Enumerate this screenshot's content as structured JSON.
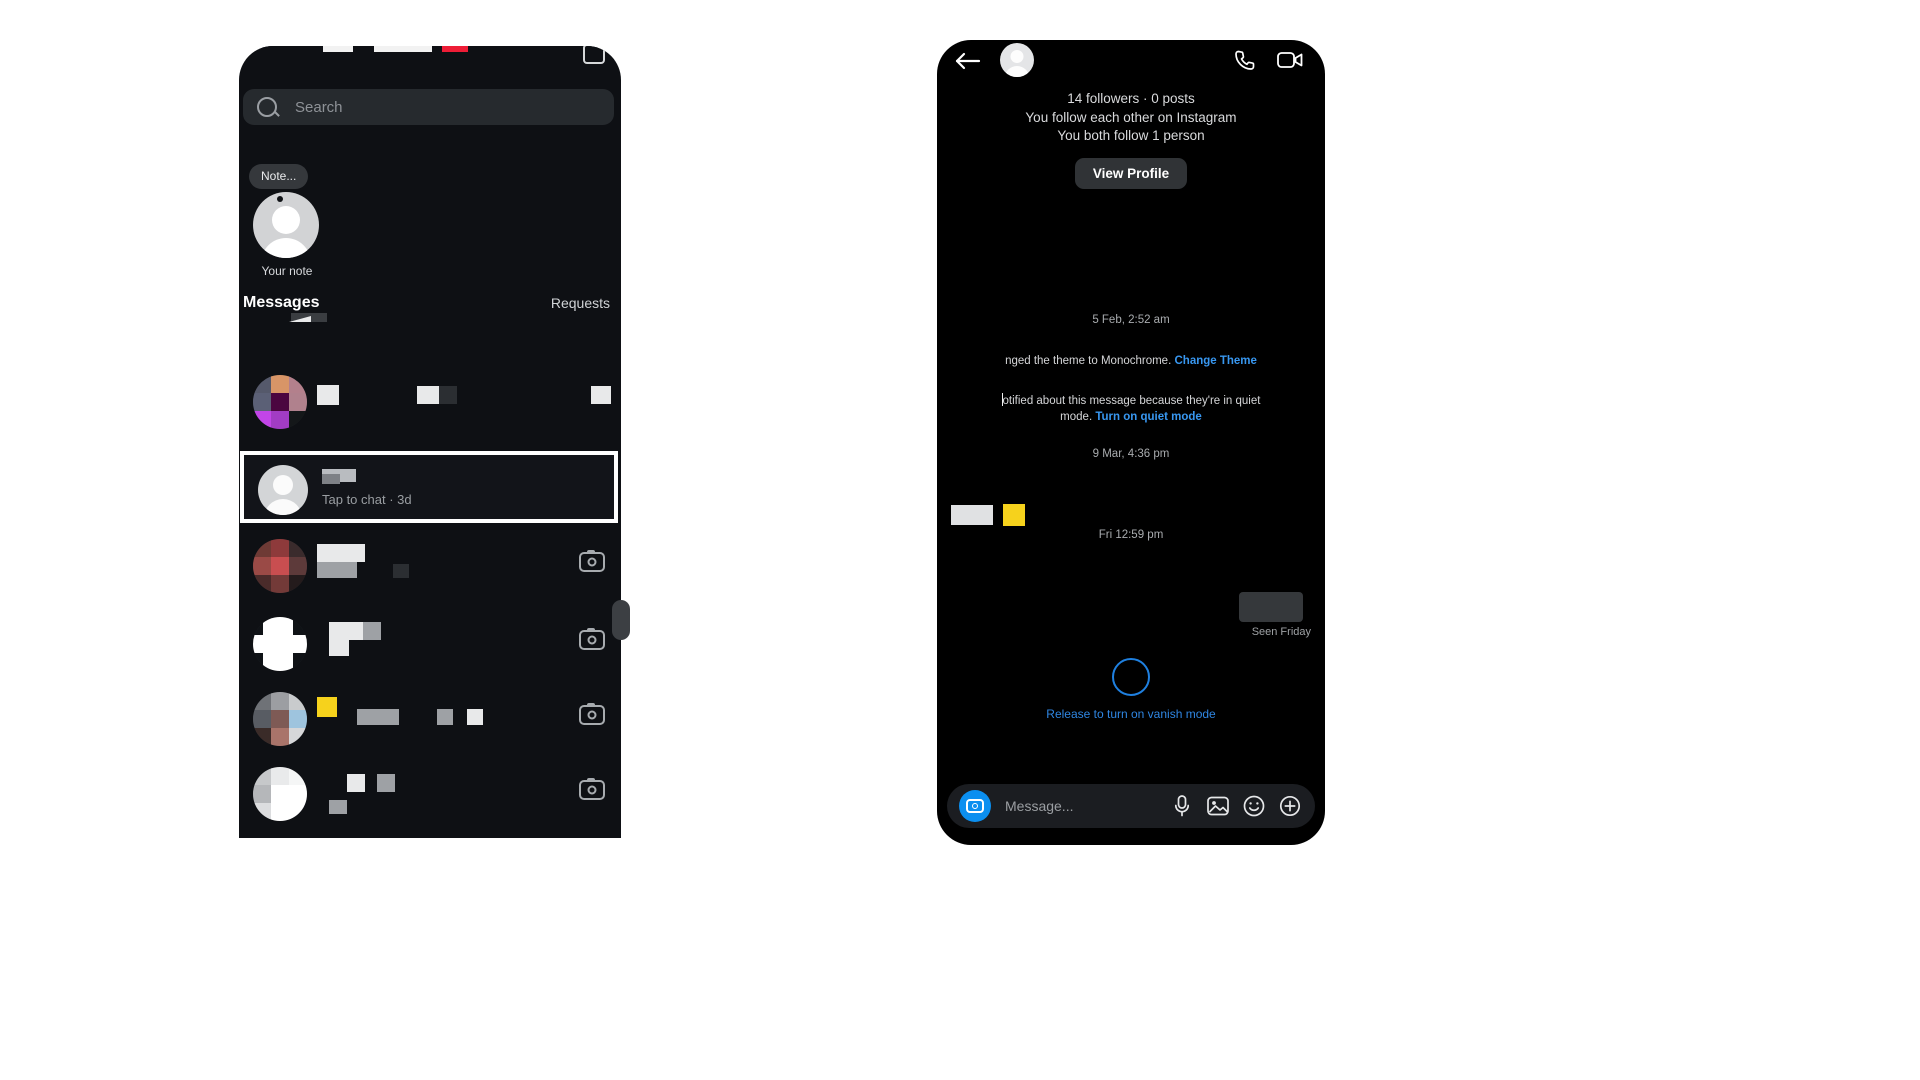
{
  "left_phone": {
    "search": {
      "placeholder": "Search"
    },
    "notes": {
      "bubble_label": "Note...",
      "avatar_label": "Your note"
    },
    "tabs": {
      "messages_label": "Messages",
      "requests_label": "Requests"
    },
    "highlighted_chat": {
      "preview": "Tap to chat · 3d"
    },
    "icons": {
      "search": "search-icon",
      "camera": "camera-icon"
    }
  },
  "right_phone": {
    "header": {
      "back": "back-arrow-icon",
      "call": "phone-call-icon",
      "video": "video-camera-icon"
    },
    "profile": {
      "stats": "14 followers · 0 posts",
      "mutual_follow": "You follow each other on Instagram",
      "mutual_people": "You both follow 1 person",
      "view_profile_label": "View Profile"
    },
    "thread": {
      "timestamp_1": "5 Feb, 2:52 am",
      "system_theme_text": "nged the theme to Monochrome.",
      "system_theme_link": "Change Theme",
      "system_quiet_text_1": "otified about this message because they're in quiet",
      "system_quiet_text_2": "mode.",
      "system_quiet_link": "Turn on quiet mode",
      "timestamp_2": "9 Mar, 4:36 pm",
      "timestamp_3": "Fri 12:59 pm",
      "seen_label": "Seen Friday"
    },
    "vanish": {
      "hint": "Release to turn on vanish mode",
      "ring_color": "#1f80e0"
    },
    "composer": {
      "placeholder": "Message...",
      "camera_bg": "#0b8ff0",
      "icons": [
        "microphone-icon",
        "gallery-icon",
        "sticker-icon",
        "plus-circle-icon"
      ]
    }
  },
  "theme": {
    "page_bg": "#ffffff",
    "left_phone_bg": "#0e1014",
    "right_phone_bg": "#000000",
    "link_blue": "#3897f0",
    "accent_blue": "#0b8ff0",
    "status_red": "#ee1d36",
    "yellow": "#f6d21c"
  }
}
